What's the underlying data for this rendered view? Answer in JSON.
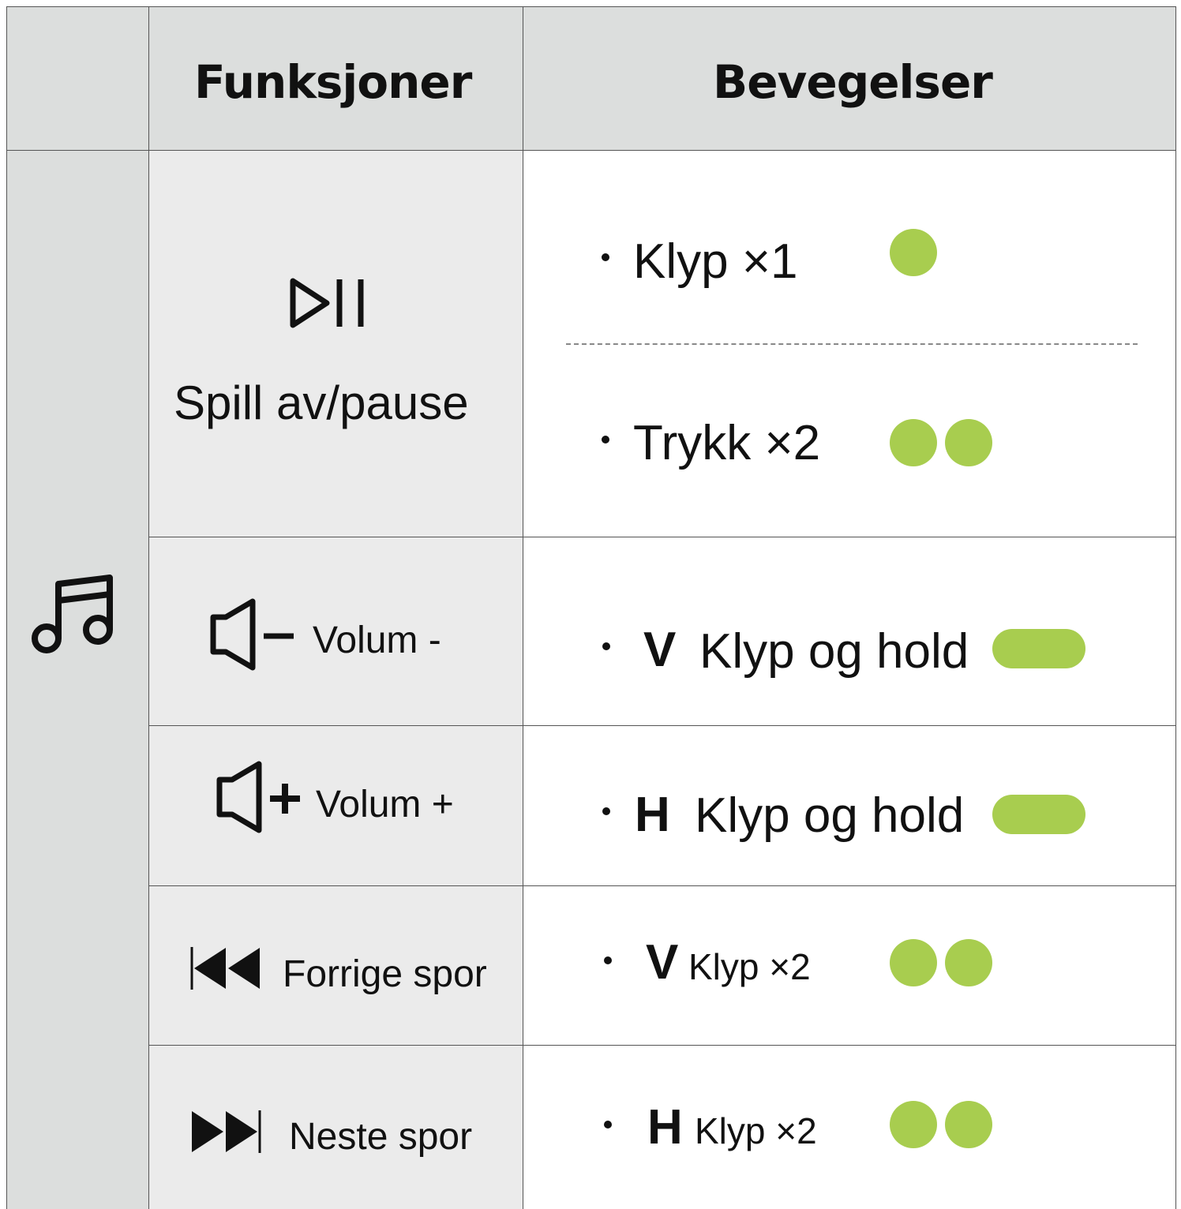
{
  "header": {
    "functions_label": "Funksjoner",
    "movements_label": "Bevegelser"
  },
  "category_icon": "music-note-icon",
  "accent_color": "#a8cd4f",
  "rows": [
    {
      "icon": "play-pause-icon",
      "function_label": "Spill av/pause",
      "gestures": [
        {
          "prefix": "",
          "label": "Klyp ×1",
          "indicator": "single-dot"
        },
        {
          "prefix": "",
          "label": "Trykk ×2",
          "indicator": "double-dot"
        }
      ]
    },
    {
      "icon": "volume-down-icon",
      "function_label": "Volum -",
      "gestures": [
        {
          "prefix": "V",
          "label": "Klyp og hold",
          "indicator": "pill"
        }
      ]
    },
    {
      "icon": "volume-up-icon",
      "function_label": "Volum +",
      "gestures": [
        {
          "prefix": "H",
          "label": "Klyp og hold",
          "indicator": "pill"
        }
      ]
    },
    {
      "icon": "previous-track-icon",
      "function_label": "Forrige spor",
      "gestures": [
        {
          "prefix": "V",
          "label": "Klyp ×2",
          "indicator": "double-dot"
        }
      ]
    },
    {
      "icon": "next-track-icon",
      "function_label": "Neste spor",
      "gestures": [
        {
          "prefix": "H",
          "label": "Klyp ×2",
          "indicator": "double-dot"
        }
      ]
    }
  ]
}
